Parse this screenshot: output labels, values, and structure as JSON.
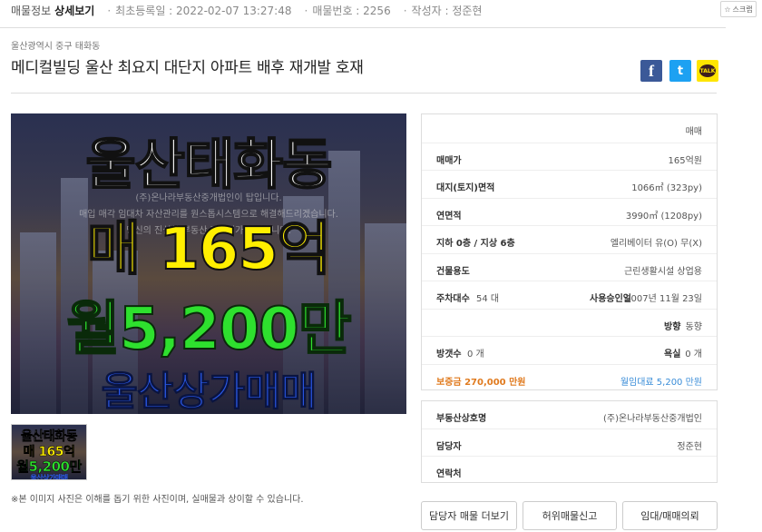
{
  "topbar": {
    "section": "매물정보",
    "section_bold": "상세보기",
    "registered": "최초등록일 : 2022-02-07 13:27:48",
    "listing_no": "매물번호 : 2256",
    "author": "작성자 : 정준현",
    "scrap_label": "스크랩"
  },
  "listing": {
    "location": "울산광역시 중구 태화동",
    "title": "메디컬빌딩 울산 최요지 대단지 아파트 배후 재개발 호재"
  },
  "share": {
    "facebook": "f",
    "twitter": "t",
    "kakao": "TALK"
  },
  "photo": {
    "line1": "울산태화동",
    "line2": "매 165억",
    "line3": "월5,200만",
    "line4": "울산상가매매",
    "ghost1": "(주)온나라부동산중개법인이 탑입니다.",
    "ghost2": "매입 매각 임대차 자산관리를 원스톱시스템으로 해결해드리겠습니다.",
    "ghost3": "당신의 진실한 부동산 파트너가 되겠습니다."
  },
  "thumb": {
    "line1": "울산태화동",
    "line2": "매 165억",
    "line3": "월5,200만",
    "line4": "울산상가매매"
  },
  "notice": "※본 이미지 사진은 이해를 돕기 위한 사진이며, 실매물과 상이할 수 있습니다.",
  "info": {
    "deal_type": "매매",
    "price_label": "매매가",
    "price": "165억원",
    "land_label": "대지(토지)면적",
    "land": "1066㎡ (323py)",
    "floor_area_label": "연면적",
    "floor_area": "3990㎡ (1208py)",
    "floors_label": "지하  0층 / 지상  6층",
    "elevator": "엘리베이터 유(O) 무(X)",
    "usage_label": "건물용도",
    "usage": "근린생활시설 상업용",
    "parking_label": "주차대수",
    "parking": "54 대",
    "approval_label": "사용승인일",
    "approval": "2007년 11월 23일",
    "direction_label": "방향",
    "direction": "동향",
    "rooms_label": "방갯수",
    "rooms": "0 개",
    "baths_label": "욕실",
    "baths": "0 개",
    "deposit": "보증금  270,000 만원",
    "monthly": "월임대료  5,200 만원"
  },
  "agent": {
    "office_label": "부동산상호명",
    "office": "(주)온나라부동산중개법인",
    "manager_label": "담당자",
    "manager": "정준현",
    "contact_label": "연락처",
    "contact": ""
  },
  "buttons": {
    "more": "담당자 매물 더보기",
    "report": "허위매물신고",
    "request": "임대/매매의뢰"
  },
  "colors": {
    "deposit": "#e07a1e",
    "monthly": "#3a8dd8",
    "facebook": "#3b5998",
    "twitter": "#1da1f2",
    "kakao": "#fee500"
  }
}
